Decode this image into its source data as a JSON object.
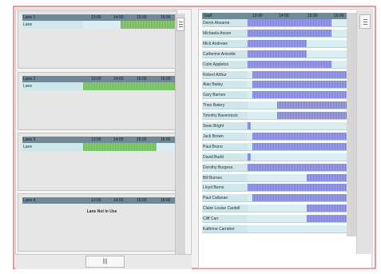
{
  "hours": [
    "13:00",
    "14:00",
    "15:00",
    "16:00"
  ],
  "lanes": [
    {
      "title": "Lane 1",
      "row_label": "Lane",
      "bookings": [
        {
          "start": 0.38,
          "end": 1.0
        }
      ],
      "notice": ""
    },
    {
      "title": "Lane 2",
      "row_label": "Lane",
      "bookings": [
        {
          "start": 0.0,
          "end": 1.0
        }
      ],
      "notice": ""
    },
    {
      "title": "Lane 3",
      "row_label": "Lane",
      "bookings": [
        {
          "start": 0.0,
          "end": 0.75
        }
      ],
      "notice": ""
    },
    {
      "title": "Lane 4",
      "row_label": "",
      "bookings": [],
      "notice": "Lane Not In Use"
    }
  ],
  "staff": {
    "header": "Staff",
    "rows": [
      {
        "name": "Derek Ahearne",
        "bookings": [
          {
            "start": 0.0,
            "end": 0.85
          }
        ]
      },
      {
        "name": "Michaela Anson",
        "bookings": [
          {
            "start": 0.0,
            "end": 0.85
          }
        ]
      },
      {
        "name": "Mick Andrews",
        "bookings": [
          {
            "start": 0.0,
            "end": 0.6
          }
        ]
      },
      {
        "name": "Catherine Anicotte",
        "bookings": [
          {
            "start": 0.0,
            "end": 0.6
          }
        ]
      },
      {
        "name": "Colin Appleton",
        "bookings": [
          {
            "start": 0.0,
            "end": 0.85
          }
        ]
      },
      {
        "name": "Robert Arthur",
        "bookings": [
          {
            "start": 0.05,
            "end": 1.0
          }
        ]
      },
      {
        "name": "Alan Bailey",
        "bookings": [
          {
            "start": 0.05,
            "end": 1.0
          }
        ]
      },
      {
        "name": "Gary Barnes",
        "bookings": [
          {
            "start": 0.05,
            "end": 1.0
          }
        ]
      },
      {
        "name": "Theo Batery",
        "bookings": [
          {
            "start": 0.3,
            "end": 1.0
          }
        ]
      },
      {
        "name": "Timothy Baverstock",
        "bookings": [
          {
            "start": 0.3,
            "end": 1.0
          }
        ]
      },
      {
        "name": "Sean Bright",
        "bookings": [
          {
            "start": 0.0,
            "end": 0.03
          }
        ]
      },
      {
        "name": "Jack Brown",
        "bookings": [
          {
            "start": 0.05,
            "end": 1.0
          }
        ]
      },
      {
        "name": "Paul Bruno",
        "bookings": [
          {
            "start": 0.05,
            "end": 1.0
          }
        ]
      },
      {
        "name": "David Budd",
        "bookings": [
          {
            "start": 0.0,
            "end": 0.03
          }
        ]
      },
      {
        "name": "Dorothy Burgess",
        "bookings": [
          {
            "start": 0.0,
            "end": 1.0
          }
        ]
      },
      {
        "name": "Bill Burnes",
        "bookings": [
          {
            "start": 0.6,
            "end": 1.0
          }
        ]
      },
      {
        "name": "Lloyd Burns",
        "bookings": [
          {
            "start": 0.0,
            "end": 1.0
          }
        ]
      },
      {
        "name": "Paul Callanan",
        "bookings": [
          {
            "start": 0.05,
            "end": 1.0
          }
        ]
      },
      {
        "name": "Claire Louise Cardell",
        "bookings": [
          {
            "start": 0.6,
            "end": 1.0
          }
        ]
      },
      {
        "name": "Cliff Carr",
        "bookings": [
          {
            "start": 0.6,
            "end": 1.0
          }
        ]
      },
      {
        "name": "Kathrine Carraher",
        "bookings": []
      }
    ]
  },
  "icons": {
    "left_scroll_thumb": "grip-lines-icon",
    "right_scroll_thumb": "grip-lines-icon",
    "bottom_scroll_thumb": "grip-vertical-icon"
  },
  "bottom_scroll_glyph": "|||",
  "colors": {
    "lane_booking": "#7fc46a",
    "staff_booking": "#8e91d8",
    "header": "#6f8a96",
    "row": "#cfe6ea"
  }
}
